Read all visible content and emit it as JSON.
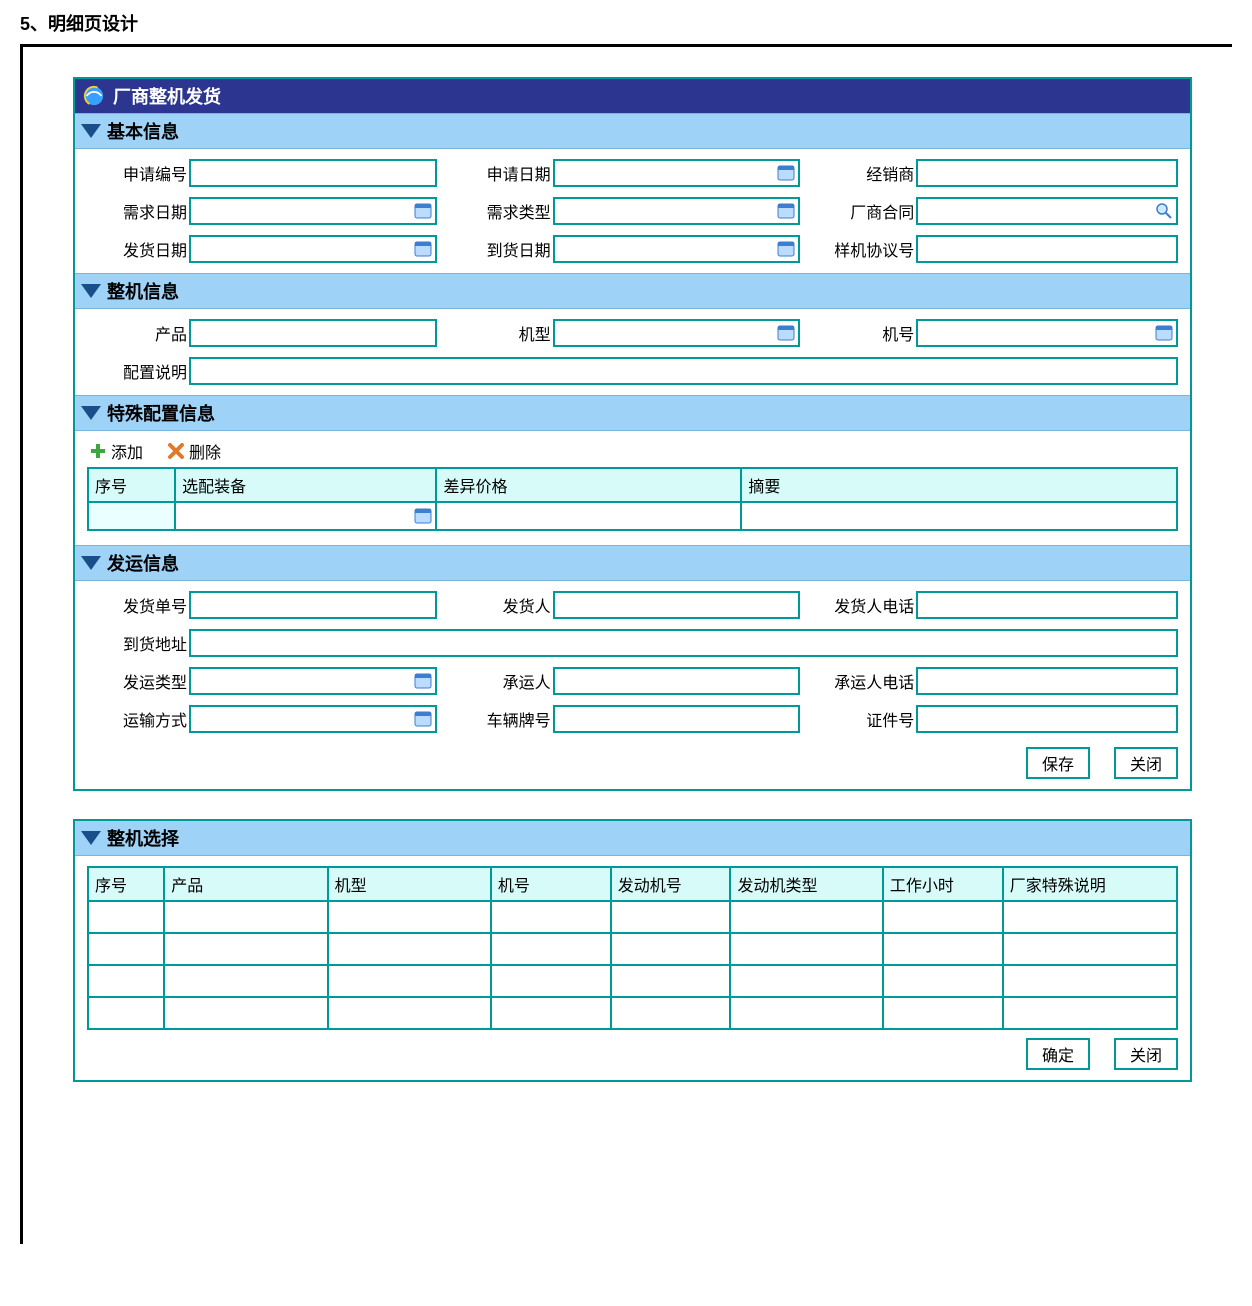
{
  "heading": "5、明细页设计",
  "titleBar": "厂商整机发货",
  "sections": {
    "basic": {
      "title": "基本信息",
      "fields": {
        "applyNo": "申请编号",
        "applyDate": "申请日期",
        "dealer": "经销商",
        "demandDate": "需求日期",
        "demandType": "需求类型",
        "mfrContract": "厂商合同",
        "shipDate": "发货日期",
        "arriveDate": "到货日期",
        "sampleAgreeNo": "样机协议号"
      }
    },
    "machine": {
      "title": "整机信息",
      "fields": {
        "product": "产品",
        "model": "机型",
        "machineNo": "机号",
        "configDesc": "配置说明"
      }
    },
    "specialCfg": {
      "title": "特殊配置信息",
      "actions": {
        "add": "添加",
        "delete": "删除"
      },
      "columns": [
        "序号",
        "选配装备",
        "差异价格",
        "摘要"
      ]
    },
    "shipInfo": {
      "title": "发运信息",
      "fields": {
        "shipNo": "发货单号",
        "shipper": "发货人",
        "shipperTel": "发货人电话",
        "arriveAddr": "到货地址",
        "shipType": "发运类型",
        "carrier": "承运人",
        "carrierTel": "承运人电话",
        "transMode": "运输方式",
        "plateNo": "车辆牌号",
        "idNo": "证件号"
      }
    },
    "machineSelect": {
      "title": "整机选择",
      "columns": [
        "序号",
        "产品",
        "机型",
        "机号",
        "发动机号",
        "发动机类型",
        "工作小时",
        "厂家特殊说明"
      ],
      "emptyRows": 4
    }
  },
  "buttons": {
    "save": "保存",
    "close": "关闭",
    "ok": "确定"
  }
}
